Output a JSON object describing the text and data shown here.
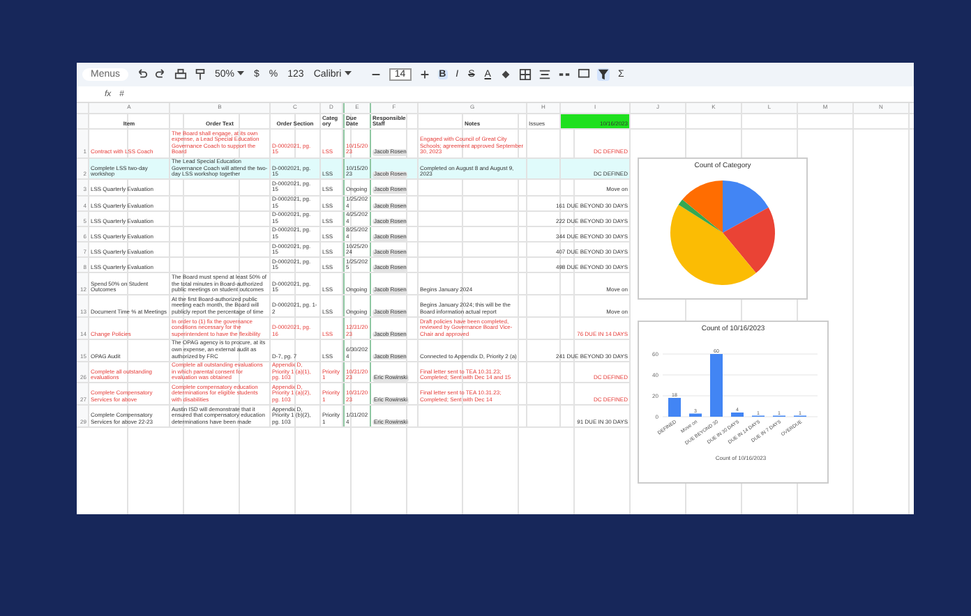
{
  "toolbar": {
    "menu": "Menus",
    "zoom": "50%",
    "currency": "$",
    "percent": "%",
    "number_format": "123",
    "font": "Calibri",
    "font_size": "14",
    "format_buttons": [
      {
        "label": "B",
        "selected": true
      },
      {
        "label": "I",
        "selected": false
      },
      {
        "label": "S",
        "selected": false
      },
      {
        "label": "A",
        "selected": false
      }
    ],
    "filter_on": true,
    "sum": "Σ"
  },
  "formula_bar": {
    "fx": "fx",
    "value": "#"
  },
  "columns": [
    "A",
    "B",
    "C",
    "D",
    "E",
    "F",
    "G",
    "H",
    "I",
    "J",
    "K",
    "L",
    "M",
    "N"
  ],
  "header": {
    "cells": [
      "Item",
      "Order Text",
      "Order Section",
      "Category",
      "Due Date",
      "Responsible Staff",
      "Notes"
    ],
    "filter_value": "Issues",
    "date_value": "10/16/2023"
  },
  "rows": [
    {
      "num": "1",
      "item": "Contract with LSS Coach",
      "text": "The Board shall engage, at its own expense, a Lead Special Education Governance Coach to support the Board",
      "section": "D-0002021, pg. 15",
      "category": "LSS",
      "due": "10/15/2023",
      "staff": "Jacob Rosen",
      "notes": "Engaged with Council of Great City Schools; agreement approved September 30, 2023",
      "status": "DC DEFINED",
      "flagged": true,
      "selected": false
    },
    {
      "num": "2",
      "item": "Complete LSS two-day workshop",
      "text": "The Lead Special Education Governance Coach will attend the two-day LSS workshop together",
      "section": "D-0002021, pg. 15",
      "category": "LSS",
      "due": "10/15/2023",
      "staff": "Jacob Rosen",
      "notes": "Completed on August 8 and August 9, 2023",
      "status": "DC DEFINED",
      "flagged": false,
      "selected": true
    },
    {
      "num": "3",
      "item": "LSS Quarterly Evaluation",
      "text": "",
      "section": "D-0002021, pg. 15",
      "category": "LSS",
      "due": "Ongoing",
      "staff": "Jacob Rosen",
      "notes": "",
      "status": "Move on",
      "flagged": false,
      "selected": false
    },
    {
      "num": "4",
      "item": "LSS Quarterly Evaluation",
      "text": "",
      "section": "D-0002021, pg. 15",
      "category": "LSS",
      "due": "1/25/2024",
      "staff": "Jacob Rosen",
      "notes": "",
      "status": "161 DUE BEYOND 30 DAYS",
      "flagged": false,
      "selected": false
    },
    {
      "num": "5",
      "item": "LSS Quarterly Evaluation",
      "text": "",
      "section": "D-0002021, pg. 15",
      "category": "LSS",
      "due": "4/25/2024",
      "staff": "Jacob Rosen",
      "notes": "",
      "status": "222 DUE BEYOND 30 DAYS",
      "flagged": false,
      "selected": false
    },
    {
      "num": "6",
      "item": "LSS Quarterly Evaluation",
      "text": "",
      "section": "D-0002021, pg. 15",
      "category": "LSS",
      "due": "8/25/2024",
      "staff": "Jacob Rosen",
      "notes": "",
      "status": "344 DUE BEYOND 30 DAYS",
      "flagged": false,
      "selected": false
    },
    {
      "num": "7",
      "item": "LSS Quarterly Evaluation",
      "text": "",
      "section": "D-0002021, pg. 15",
      "category": "LSS",
      "due": "10/25/2024",
      "staff": "Jacob Rosen",
      "notes": "",
      "status": "407 DUE BEYOND 30 DAYS",
      "flagged": false,
      "selected": false
    },
    {
      "num": "8",
      "item": "LSS Quarterly Evaluation",
      "text": "",
      "section": "D-0002021, pg. 15",
      "category": "LSS",
      "due": "1/25/2025",
      "staff": "Jacob Rosen",
      "notes": "",
      "status": "498 DUE BEYOND 30 DAYS",
      "flagged": false,
      "selected": false
    },
    {
      "num": "12",
      "item": "Spend 50% on Student Outcomes",
      "text": "The Board must spend at least 50% of the total minutes in Board-authorized public meetings on student outcomes",
      "section": "D-0002021, pg. 15",
      "category": "LSS",
      "due": "Ongoing",
      "staff": "Jacob Rosen",
      "notes": "Begins January 2024",
      "status": "Move on",
      "flagged": false,
      "selected": false
    },
    {
      "num": "13",
      "item": "Document Time % at Meetings",
      "text": "At the first Board-authorized public meeting each month, the Board will publicly report the percentage of time",
      "section": "D-0002021, pg. 1-2",
      "category": "LSS",
      "due": "Ongoing",
      "staff": "Jacob Rosen",
      "notes": "Begins January 2024; this will be the Board information actual report",
      "status": "Move on",
      "flagged": false,
      "selected": false
    },
    {
      "num": "14",
      "item": "Change Policies",
      "text": "In order to (1) fix the governance conditions necessary for the superintendent to have the flexibility",
      "section": "D-0002021, pg. 16",
      "category": "LSS",
      "due": "12/31/2023",
      "staff": "Jacob Rosen",
      "notes": "Draft policies have been completed, reviewed by Governance Board Vice-Chair and approved",
      "status": "76 DUE IN 14 DAYS",
      "flagged": true,
      "selected": false
    },
    {
      "num": "15",
      "item": "OPAG Audit",
      "text": "The OPAG agency is to procure, at its own expense, an external audit as authorized by FRC",
      "section": "D-7, pg. 7",
      "category": "LSS",
      "due": "6/30/2024",
      "staff": "Jacob Rosen",
      "notes": "Connected to Appendix D, Priority 2 (a)",
      "status": "241 DUE BEYOND 30 DAYS",
      "flagged": false,
      "selected": false
    },
    {
      "num": "26",
      "item": "Complete all outstanding evaluations",
      "text": "Complete all outstanding evaluations in which parental consent for evaluation was obtained",
      "section": "Appendix D, Priority 1 (a)(1), pg. 103",
      "category": "Priority 1",
      "due": "10/31/2023",
      "staff": "Eric Rowinski",
      "notes": "Final letter sent to TEA 10.31.23; Completed; Sent with Dec 14 and 15",
      "status": "DC DEFINED",
      "flagged": true,
      "selected": false
    },
    {
      "num": "27",
      "item": "Complete Compensatory Services for above",
      "text": "Complete compensatory education determinations for eligible students with disabilities",
      "section": "Appendix D, Priority 1 (a)(2), pg. 103",
      "category": "Priority 1",
      "due": "10/31/2023",
      "staff": "Eric Rowinski",
      "notes": "Final letter sent to TEA 10.31.23; Completed; Sent with Dec 14",
      "status": "DC DEFINED",
      "flagged": true,
      "selected": false
    },
    {
      "num": "29",
      "item": "Complete Compensatory Services for above 22-23",
      "text": "Austin ISD will demonstrate that it ensured that compensatory education determinations have been made",
      "section": "Appendix D, Priority 1 (b)(2), pg. 103",
      "category": "Priority 1",
      "due": "1/31/2024",
      "staff": "Eric Rowinski",
      "notes": "",
      "status": "91 DUE IN 30 DAYS",
      "flagged": false,
      "selected": false
    }
  ],
  "charts": [
    {
      "kind": "pie",
      "title": "Count of Category",
      "slices": [
        {
          "color": "#4285f4"
        },
        {
          "color": "#ea4335"
        },
        {
          "color": "#fbbc04"
        },
        {
          "color": "#34a853"
        },
        {
          "color": "#ff6d01"
        }
      ]
    },
    {
      "kind": "bar",
      "chart_data": {
        "type": "bar",
        "title": "Count of 10/16/2023",
        "xlabel": "Count of 10/16/2023",
        "categories": [
          "DEFINED",
          "Move on",
          "DUE BEYOND 30",
          "DUE IN 30 DAYS",
          "DUE IN 14 DAYS",
          "DUE IN 7 DAYS",
          "OVERDUE"
        ],
        "ylim": [
          0,
          60
        ],
        "yticks": [
          0,
          20,
          40,
          60
        ],
        "series": [
          {
            "color": "#4285f4",
            "values": [
              18,
              3,
              60,
              4,
              1,
              1,
              1
            ]
          }
        ],
        "data_labels": true
      }
    }
  ]
}
